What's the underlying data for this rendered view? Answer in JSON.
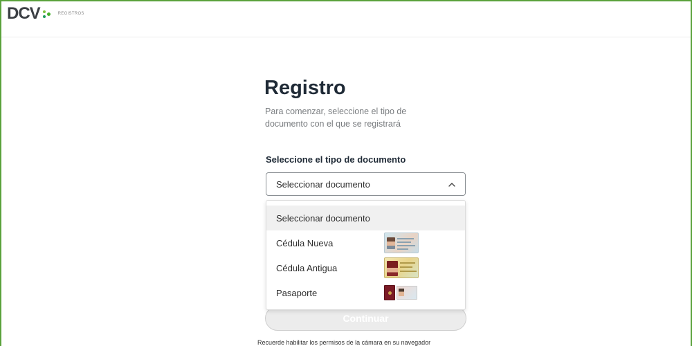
{
  "header": {
    "brand": "DCV",
    "section": "REGISTROS"
  },
  "main": {
    "title": "Registro",
    "subtitle": "Para comenzar, seleccione el tipo de documento con el que se registrará",
    "field_label": "Seleccione el tipo de documento",
    "select_value": "Seleccionar documento",
    "options": [
      {
        "label": "Seleccionar documento",
        "image": null
      },
      {
        "label": "Cédula Nueva",
        "image": "new-id-card-image"
      },
      {
        "label": "Cédula Antigua",
        "image": "old-id-card-image"
      },
      {
        "label": "Pasaporte",
        "image": "passport-image"
      }
    ],
    "continue_label": "Continuar",
    "note": "Recuerde habilitar los permisos de la cámara en su navegador"
  },
  "colors": {
    "frame_border": "#5aa23c",
    "brand_green": "#43b02a",
    "title": "#1f2a36"
  }
}
